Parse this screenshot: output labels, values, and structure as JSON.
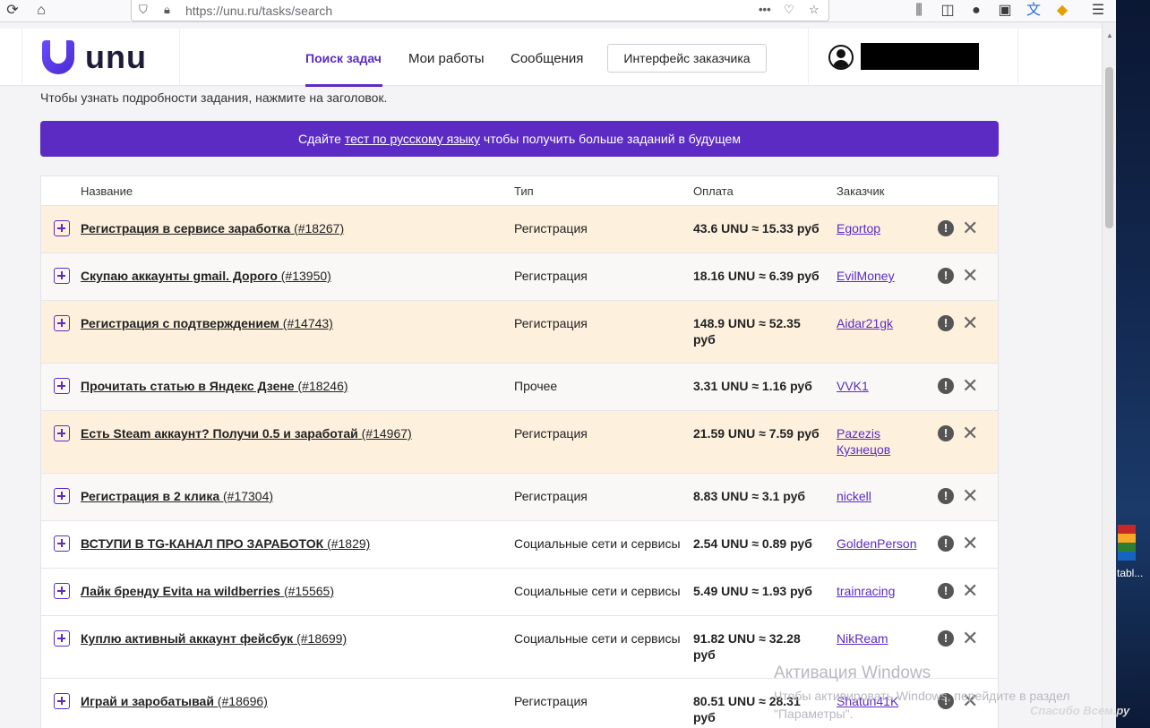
{
  "browser": {
    "url": "https://unu.ru/tasks/search"
  },
  "header": {
    "logo_text": "unu",
    "nav": [
      "Поиск задач",
      "Мои работы",
      "Сообщения"
    ],
    "client_button": "Интерфейс заказчика"
  },
  "page": {
    "hint": "Чтобы узнать подробности задания, нажмите на заголовок.",
    "banner_pre": "Сдайте ",
    "banner_link": "тест по русскому языку",
    "banner_post": " чтобы получить больше заданий в будущем"
  },
  "table": {
    "headers": [
      "Название",
      "Тип",
      "Оплата",
      "Заказчик"
    ],
    "rows": [
      {
        "title": "Регистрация в сервисе заработка",
        "id": "(#18267)",
        "type": "Регистрация",
        "pay1": "43.6 UNU ≈ 15.33 руб",
        "pay2": "",
        "cust1": "Egortop",
        "cust2": ""
      },
      {
        "title": "Скупаю аккаунты gmail. Дорого",
        "id": "(#13950)",
        "type": "Регистрация",
        "pay1": "18.16 UNU ≈ 6.39 руб",
        "pay2": "",
        "cust1": "EvilMoney",
        "cust2": ""
      },
      {
        "title": "Регистрация с подтверждением",
        "id": "(#14743)",
        "type": "Регистрация",
        "pay1": "148.9 UNU ≈ 52.35",
        "pay2": "руб",
        "cust1": "Aidar21gk",
        "cust2": ""
      },
      {
        "title": "Прочитать статью в Яндекс Дзене",
        "id": "(#18246)",
        "type": "Прочее",
        "pay1": "3.31 UNU ≈ 1.16 руб",
        "pay2": "",
        "cust1": "VVK1",
        "cust2": ""
      },
      {
        "title": "Есть Steam аккаунт? Получи 0.5 и заработай",
        "id": "(#14967)",
        "type": "Регистрация",
        "pay1": "21.59 UNU ≈ 7.59 руб",
        "pay2": "",
        "cust1": "Pazezis",
        "cust2": "Кузнецов"
      },
      {
        "title": "Регистрация в 2 клика",
        "id": "(#17304)",
        "type": "Регистрация",
        "pay1": "8.83 UNU ≈ 3.1 руб",
        "pay2": "",
        "cust1": "nickell",
        "cust2": ""
      },
      {
        "title": "ВСТУПИ В TG-КАНАЛ ПРО ЗАРАБОТОК",
        "id": "(#1829)",
        "type": "Социальные сети и сервисы",
        "pay1": "2.54 UNU ≈ 0.89 руб",
        "pay2": "",
        "cust1": "GoldenPerson",
        "cust2": ""
      },
      {
        "title": "Лайк бренду Evita на wildberries",
        "id": "(#15565)",
        "type": "Социальные сети и сервисы",
        "pay1": "5.49 UNU ≈ 1.93 руб",
        "pay2": "",
        "cust1": "trainracing",
        "cust2": ""
      },
      {
        "title": "Куплю активный аккаунт фейсбук",
        "id": "(#18699)",
        "type": "Социальные сети и сервисы",
        "pay1": "91.82 UNU ≈ 32.28",
        "pay2": "руб",
        "cust1": "NikReam",
        "cust2": ""
      },
      {
        "title": "Играй и заробатывай",
        "id": "(#18696)",
        "type": "Регистрация",
        "pay1": "80.51 UNU ≈ 28.31",
        "pay2": "руб",
        "cust1": "Shatun41K",
        "cust2": ""
      }
    ]
  },
  "overlay": {
    "win_title": "Активация Windows",
    "win_line1": "Чтобы активировать Windows, перейдите в раздел",
    "win_line2": "\"Параметры\".",
    "desktop_label": "tabl...",
    "otz": "Спасибо Всем.ру"
  }
}
